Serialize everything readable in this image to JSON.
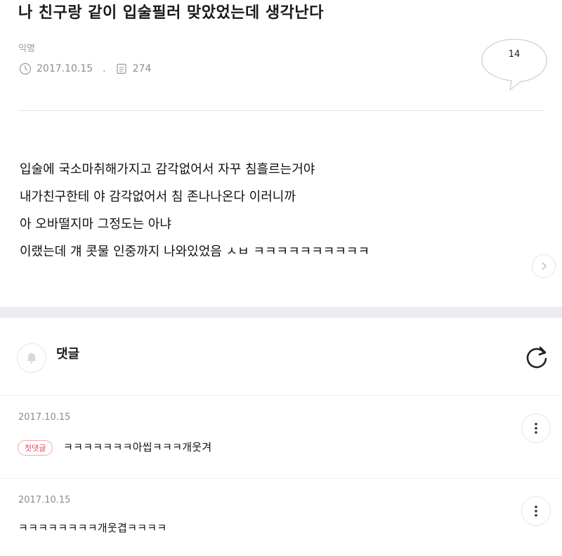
{
  "post": {
    "title": "나 친구랑 같이 입술필러 맞았었는데 생각난다",
    "author": "익명",
    "date": "2017.10.15",
    "separator": ".",
    "views": "274",
    "comment_count": "14",
    "body_lines": [
      "입술에 국소마취해가지고 감각없어서 자꾸 침흘르는거야",
      "내가친구한테 야 감각없어서 침 존나나온다 이러니까",
      "아 오바떨지마 그정도는 아냐",
      "이랬는데 걔 콧물 인중까지 나와있었음 ㅅㅂ ㅋㅋㅋㅋㅋㅋㅋㅋㅋㅋ"
    ]
  },
  "comments_section": {
    "label": "댓글"
  },
  "comments": [
    {
      "date": "2017.10.15",
      "badge": "첫댓글",
      "text": "ㅋㅋㅋㅋㅋㅋㅋ아씹ㅋㅋㅋ개웃겨"
    },
    {
      "date": "2017.10.15",
      "text": "ㅋㅋㅋㅋㅋㅋㅋㅋ개웃겹ㅋㅋㅋㅋ"
    }
  ],
  "icons": {
    "date": "clock-icon",
    "views": "document-icon",
    "comment_bubble": "speech-bubble-icon",
    "next": "chevron-right-icon",
    "notify": "bell-icon",
    "refresh": "refresh-icon",
    "more": "more-vertical-icon"
  },
  "colors": {
    "badge_border": "#f3a5b0",
    "badge_text": "#e0485f",
    "section_band": "#ececf0"
  }
}
